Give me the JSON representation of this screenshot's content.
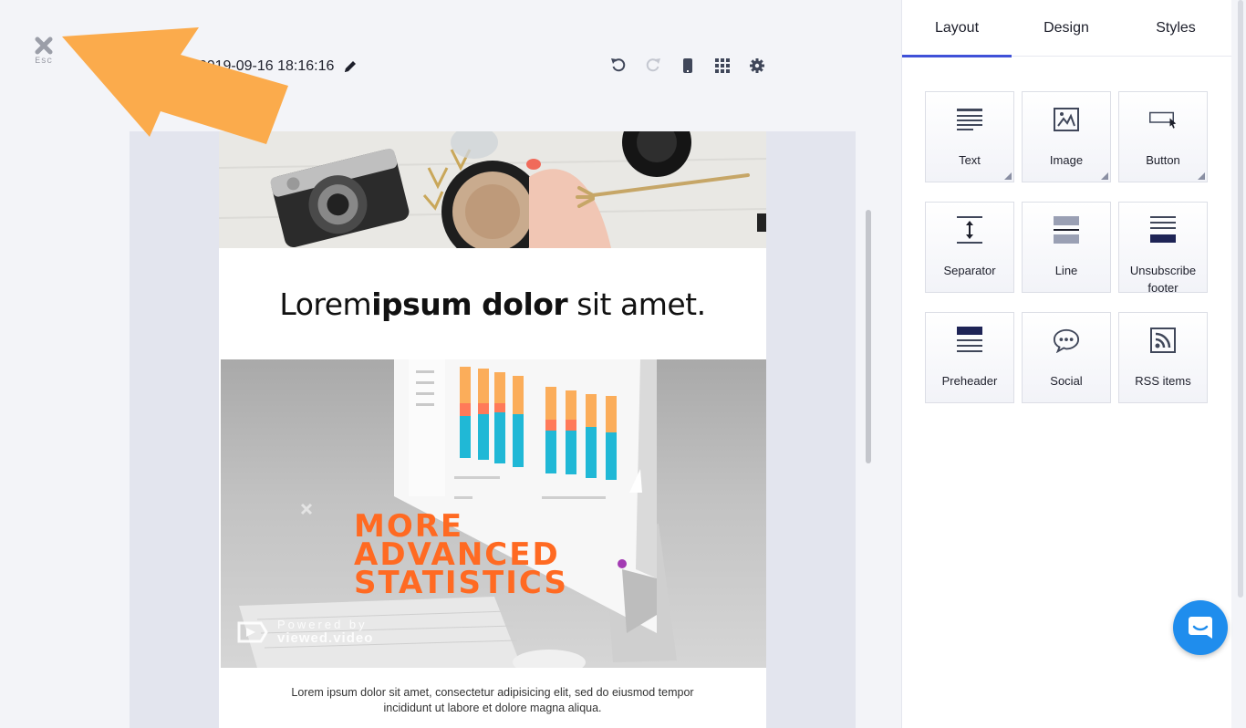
{
  "header": {
    "esc_label": "Esc",
    "title": "n: 2019-09-16 18:16:16"
  },
  "toolbar": {
    "undo": "undo-icon",
    "redo": "redo-icon",
    "mobile": "mobile-preview-icon",
    "grid": "grid-icon",
    "settings": "gear-icon"
  },
  "email": {
    "headline_regular_1": "Lorem",
    "headline_bold": "ipsum dolor",
    "headline_regular_2": " sit amet.",
    "promo_line1": "MORE",
    "promo_line2": "ADVANCED",
    "promo_line3": "STATISTICS",
    "powered_by": "Powered by",
    "powered_brand": "viewed.video",
    "body_text": "Lorem ipsum dolor sit amet, consectetur adipisicing elit, sed do eiusmod tempor incididunt ut labore et dolore magna aliqua."
  },
  "panel": {
    "tabs": [
      {
        "label": "Layout"
      },
      {
        "label": "Design"
      },
      {
        "label": "Styles"
      }
    ],
    "blocks": [
      {
        "label": "Text",
        "icon": "text-icon"
      },
      {
        "label": "Image",
        "icon": "image-icon"
      },
      {
        "label": "Button",
        "icon": "button-icon"
      },
      {
        "label": "Separator",
        "icon": "separator-icon"
      },
      {
        "label": "Line",
        "icon": "line-icon"
      },
      {
        "label": "Unsubscribe footer",
        "icon": "unsubscribe-footer-icon"
      },
      {
        "label": "Preheader",
        "icon": "preheader-icon"
      },
      {
        "label": "Social",
        "icon": "chat-bubble-icon"
      },
      {
        "label": "RSS items",
        "icon": "rss-icon"
      }
    ]
  },
  "colors": {
    "accent": "#3f51d8",
    "promo_orange": "#ff6a22",
    "annotation_arrow": "#fbab4c",
    "chat_button": "#1f8ded"
  }
}
